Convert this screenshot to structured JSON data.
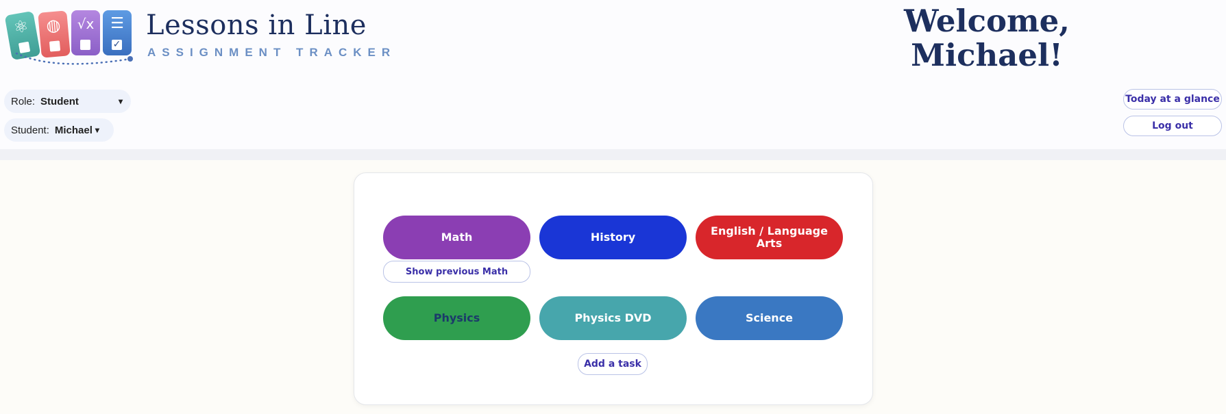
{
  "app": {
    "title": "Lessons in Line",
    "subtitle": "ASSIGNMENT TRACKER",
    "welcome_line1": "Welcome,",
    "welcome_line2": "Michael!"
  },
  "logo": {
    "icons": [
      "atom-icon",
      "globe-icon",
      "sqrt-x-icon",
      "checklist-icon"
    ],
    "colors": [
      "#4fb3a9",
      "#ef7575",
      "#a276d6",
      "#4a86d4"
    ]
  },
  "controls": {
    "role_label": "Role:",
    "role_value": "Student",
    "student_label": "Student:",
    "student_value": "Michael",
    "today_label": "Today at a glance",
    "logout_label": "Log out"
  },
  "subjects": [
    {
      "label": "Math",
      "color": "#8b3eb3"
    },
    {
      "label": "History",
      "color": "#1a36d6"
    },
    {
      "label": "English / Language Arts",
      "color": "#d8262b"
    },
    {
      "label": "Physics",
      "color": "#2f9e4f"
    },
    {
      "label": "Physics DVD",
      "color": "#47a6ac"
    },
    {
      "label": "Science",
      "color": "#3a78c2"
    }
  ],
  "actions": {
    "show_previous_math": "Show previous Math",
    "add_task": "Add a task"
  }
}
